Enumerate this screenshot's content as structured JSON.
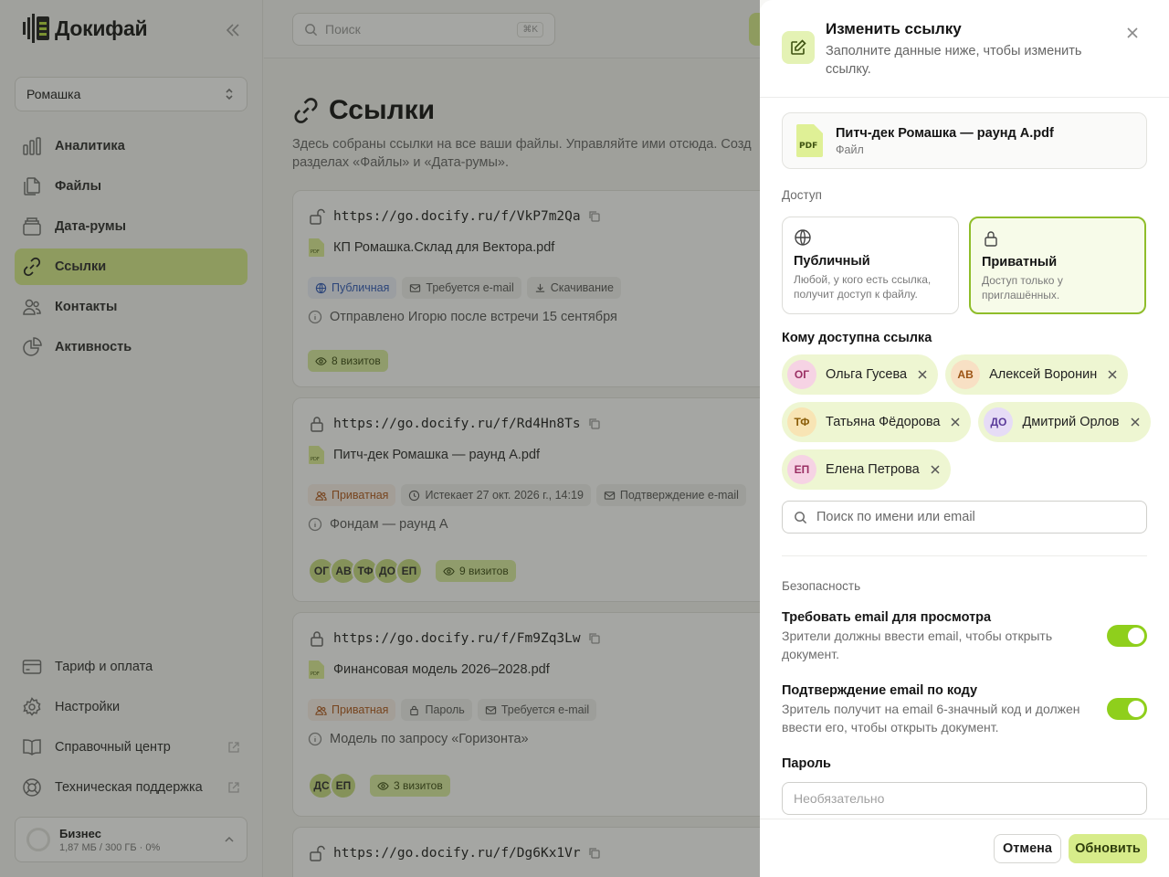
{
  "app": {
    "name": "Докифай"
  },
  "sidebar": {
    "workspace": "Ромашка",
    "nav": [
      {
        "label": "Аналитика",
        "icon": "chart-bar-icon"
      },
      {
        "label": "Файлы",
        "icon": "files-icon"
      },
      {
        "label": "Дата-румы",
        "icon": "box-icon"
      },
      {
        "label": "Ссылки",
        "icon": "link-icon",
        "active": true
      },
      {
        "label": "Контакты",
        "icon": "users-icon"
      },
      {
        "label": "Активность",
        "icon": "pie-icon"
      }
    ],
    "bottom": [
      {
        "label": "Тариф и оплата",
        "icon": "credit-card-icon"
      },
      {
        "label": "Настройки",
        "icon": "gear-icon"
      },
      {
        "label": "Справочный центр",
        "icon": "book-icon",
        "external": true
      },
      {
        "label": "Техническая поддержка",
        "icon": "lifebuoy-icon",
        "external": true
      }
    ],
    "plan": {
      "name": "Бизнес",
      "usage": "1,87 МБ / 300 ГБ · 0%"
    }
  },
  "topbar": {
    "search_placeholder": "Поиск",
    "shortcut": "⌘K"
  },
  "page": {
    "title": "Ссылки",
    "description": "Здесь собраны ссылки на все ваши файлы. Управляйте ими отсюда. Созд разделах «Файлы» и «Дата-румы»."
  },
  "links": [
    {
      "url": "https://go.docify.ru/f/VkP7m2Qa",
      "file": "КП Ромашка.Склад для Вектора.pdf",
      "tags": [
        "Публичная",
        "Требуется e-mail",
        "Скачивание"
      ],
      "note": "Отправлено Игорю после встречи 15 сентября",
      "avatars": [],
      "visits": "8 визитов"
    },
    {
      "url": "https://go.docify.ru/f/Rd4Hn8Ts",
      "file": "Питч-дек Ромашка — раунд A.pdf",
      "tags": [
        "Приватная",
        "Истекает 27 окт. 2026 г., 14:19",
        "Подтверждение e-mail"
      ],
      "note": "Фондам — раунд А",
      "avatars": [
        "ОГ",
        "АВ",
        "ТФ",
        "ДО",
        "ЕП"
      ],
      "visits": "9 визитов"
    },
    {
      "url": "https://go.docify.ru/f/Fm9Zq3Lw",
      "file": "Финансовая модель 2026–2028.pdf",
      "tags": [
        "Приватная",
        "Пароль",
        "Требуется e-mail"
      ],
      "note": "Модель по запросу «Горизонта»",
      "avatars": [
        "ДС",
        "ЕП"
      ],
      "visits": "3 визитов"
    },
    {
      "url": "https://go.docify.ru/f/Dg6Kx1Vr"
    }
  ],
  "drawer": {
    "title": "Изменить ссылку",
    "subtitle": "Заполните данные ниже, чтобы изменить ссылку.",
    "file": {
      "name": "Питч-дек Ромашка — раунд A.pdf",
      "kind": "Файл",
      "badge": "PDF"
    },
    "access_label": "Доступ",
    "access": [
      {
        "title": "Публичный",
        "desc": "Любой, у кого есть ссылка, получит доступ к файлу."
      },
      {
        "title": "Приватный",
        "desc": "Доступ только у приглашённых."
      }
    ],
    "recipients_label": "Кому доступна ссылка",
    "recipients": [
      {
        "initials": "ОГ",
        "name": "Ольга Гусева",
        "color": "#f6d3e4",
        "text": "#9a2f63"
      },
      {
        "initials": "АВ",
        "name": "Алексей Воронин",
        "color": "#f8e0c4",
        "text": "#9c5314"
      },
      {
        "initials": "ТФ",
        "name": "Татьяна Фёдорова",
        "color": "#f8e4b4",
        "text": "#8a5c08"
      },
      {
        "initials": "ДО",
        "name": "Дмитрий Орлов",
        "color": "#e6dcf6",
        "text": "#5a3a9a"
      },
      {
        "initials": "ЕП",
        "name": "Елена Петрова",
        "color": "#f6d3e4",
        "text": "#9a2f63"
      }
    ],
    "search_placeholder": "Поиск по имени или email",
    "security_label": "Безопасность",
    "options": [
      {
        "title": "Требовать email для просмотра",
        "desc": "Зрители должны ввести email, чтобы открыть документ.",
        "on": true
      },
      {
        "title": "Подтверждение email по коду",
        "desc": "Зритель получит на email 6-значный код и должен ввести его, чтобы открыть документ.",
        "on": true
      }
    ],
    "password_label": "Пароль",
    "password_placeholder": "Необязательно",
    "cancel": "Отмена",
    "submit": "Обновить"
  }
}
